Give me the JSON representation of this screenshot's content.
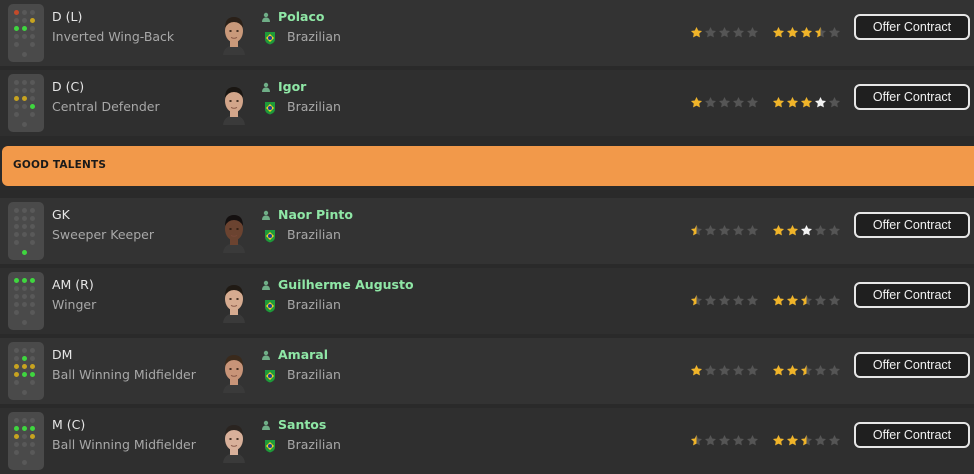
{
  "section": {
    "title": "GOOD TALENTS"
  },
  "colors": {
    "accent_bar": "#f2994a",
    "player_name": "#8fe7a6",
    "star_gold": "#f0b429",
    "star_empty": "#555555",
    "star_white": "#f2f2f2"
  },
  "players": [
    {
      "position": "D (L)",
      "role": "Inverted Wing-Back",
      "name": "Polaco",
      "nationality": "Brazilian",
      "skin": "#c9997a",
      "hair": "#2a2018",
      "current_ability": 1,
      "potential_ability": 3.5,
      "potential_extra": 0,
      "button_label": "Offer Contract",
      "pitch_dots": [
        "low",
        "off",
        "off",
        "off",
        "off",
        "mid",
        "on",
        "on",
        "off",
        "off",
        "off",
        "off",
        "off",
        "off",
        "off"
      ]
    },
    {
      "position": "D (C)",
      "role": "Central Defender",
      "name": "Igor",
      "nationality": "Brazilian",
      "skin": "#d2a58a",
      "hair": "#1a1612",
      "current_ability": 1,
      "potential_ability": 3,
      "potential_extra": 1,
      "button_label": "Offer Contract",
      "pitch_dots": [
        "off",
        "off",
        "off",
        "off",
        "off",
        "off",
        "mid",
        "mid",
        "off",
        "off",
        "off",
        "on",
        "off",
        "off",
        "off"
      ]
    },
    {
      "position": "GK",
      "role": "Sweeper Keeper",
      "name": "Naor Pinto",
      "nationality": "Brazilian",
      "skin": "#6b4330",
      "hair": "#141010",
      "current_ability": 0.5,
      "potential_ability": 2,
      "potential_extra": 1,
      "button_label": "Offer Contract",
      "pitch_dots": [
        "off",
        "off",
        "off",
        "off",
        "off",
        "off",
        "off",
        "off",
        "off",
        "off",
        "off",
        "off",
        "off",
        "off",
        "on"
      ]
    },
    {
      "position": "AM (R)",
      "role": "Winger",
      "name": "Guilherme Augusto",
      "nationality": "Brazilian",
      "skin": "#d6ab90",
      "hair": "#201a14",
      "current_ability": 0.5,
      "potential_ability": 2.5,
      "potential_extra": 0,
      "button_label": "Offer Contract",
      "pitch_dots": [
        "on",
        "on",
        "on",
        "off",
        "off",
        "off",
        "off",
        "off",
        "off",
        "off",
        "off",
        "off",
        "off",
        "off",
        "off"
      ]
    },
    {
      "position": "DM",
      "role": "Ball Winning Midfielder",
      "name": "Amaral",
      "nationality": "Brazilian",
      "skin": "#c89478",
      "hair": "#3a2a1c",
      "current_ability": 1,
      "potential_ability": 2.5,
      "potential_extra": 0,
      "button_label": "Offer Contract",
      "pitch_dots": [
        "off",
        "off",
        "off",
        "off",
        "on",
        "off",
        "mid",
        "mid",
        "mid",
        "mid",
        "on",
        "on",
        "off",
        "off",
        "off"
      ]
    },
    {
      "position": "M (C)",
      "role": "Ball Winning Midfielder",
      "name": "Santos",
      "nationality": "Brazilian",
      "skin": "#d8b09a",
      "hair": "#2a2420",
      "current_ability": 0.5,
      "potential_ability": 2.5,
      "potential_extra": 0,
      "button_label": "Offer Contract",
      "pitch_dots": [
        "off",
        "off",
        "off",
        "on",
        "on",
        "on",
        "mid",
        "off",
        "mid",
        "off",
        "off",
        "off",
        "off",
        "off",
        "off"
      ]
    }
  ]
}
